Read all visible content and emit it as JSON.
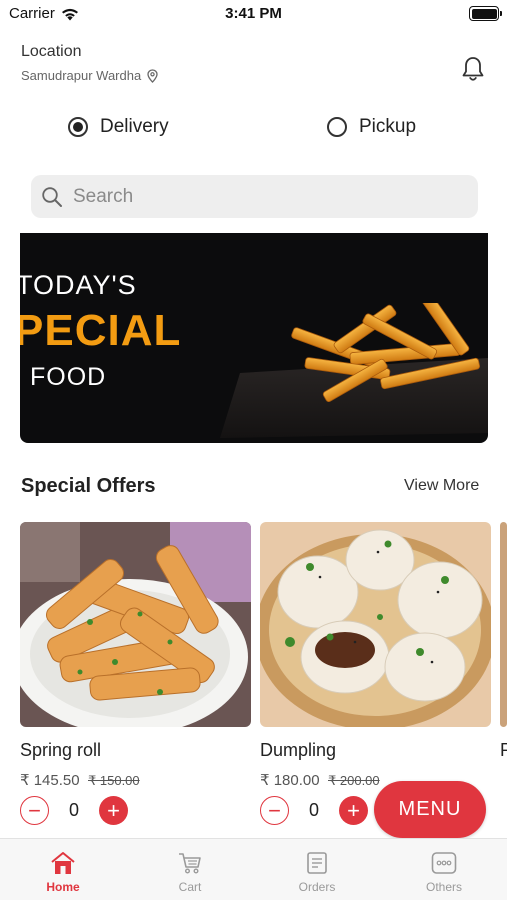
{
  "status_bar": {
    "carrier": "Carrier",
    "time": "3:41 PM"
  },
  "header": {
    "location_title": "Location",
    "location_value": "Samudrapur Wardha"
  },
  "order_type": {
    "options": [
      {
        "label": "Delivery",
        "selected": true
      },
      {
        "label": "Pickup",
        "selected": false
      }
    ]
  },
  "search": {
    "placeholder": "Search",
    "value": ""
  },
  "banner": {
    "line1": "TODAY'S",
    "line2": "PECIAL",
    "line3": "FOOD"
  },
  "special_offers": {
    "title": "Special Offers",
    "view_more": "View More",
    "items": [
      {
        "name": "Spring roll",
        "price": "₹ 145.50",
        "old_price": "₹ 150.00",
        "qty": "0"
      },
      {
        "name": "Dumpling",
        "price": "₹ 180.00",
        "old_price": "₹ 200.00",
        "qty": "0"
      }
    ]
  },
  "menu_button": "MENU",
  "bottom_nav": {
    "items": [
      {
        "label": "Home",
        "icon": "home-icon",
        "active": true
      },
      {
        "label": "Cart",
        "icon": "cart-icon",
        "active": false
      },
      {
        "label": "Orders",
        "icon": "orders-icon",
        "active": false
      },
      {
        "label": "Others",
        "icon": "more-icon",
        "active": false
      }
    ]
  },
  "colors": {
    "accent": "#e0363f",
    "banner_orange": "#f39c12",
    "banner_bg": "#0c0c0d"
  }
}
